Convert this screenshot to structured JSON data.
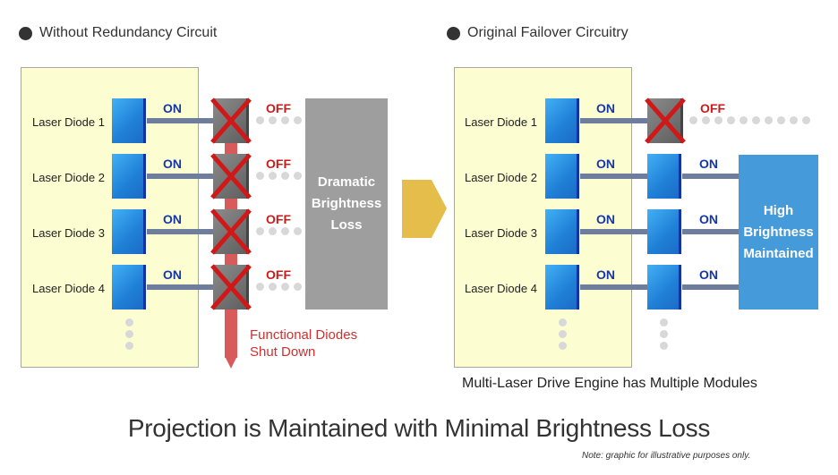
{
  "left": {
    "heading": "Without Redundancy Circuit",
    "diodes": [
      "Laser Diode 1",
      "Laser Diode 2",
      "Laser Diode 3",
      "Laser Diode 4"
    ],
    "on_label": "ON",
    "off_label": "OFF",
    "result_lines": [
      "Dramatic",
      "Brightness",
      "Loss"
    ],
    "arrow_caption_lines": [
      "Functional Diodes",
      "Shut Down"
    ]
  },
  "right": {
    "heading": "Original Failover Circuitry",
    "diodes": [
      "Laser Diode 1",
      "Laser Diode 2",
      "Laser Diode 3",
      "Laser Diode 4"
    ],
    "on_label": "ON",
    "off_label": "OFF",
    "result_lines": [
      "High",
      "Brightness",
      "Maintained"
    ],
    "caption": "Multi-Laser Drive Engine has Multiple Modules"
  },
  "title": "Projection is Maintained with Minimal Brightness Loss",
  "note": "Note: graphic for illustrative purposes only.",
  "colors": {
    "panel": "#fdfdd2",
    "diode_blue": "#2a8ce0",
    "on_text": "#1537a8",
    "off_text": "#cc1b1b",
    "loss_box": "#9e9e9e",
    "maintained_box": "#459ad9",
    "arrow": "#e4bd4a",
    "shutdown_bar": "#d95a5a"
  }
}
